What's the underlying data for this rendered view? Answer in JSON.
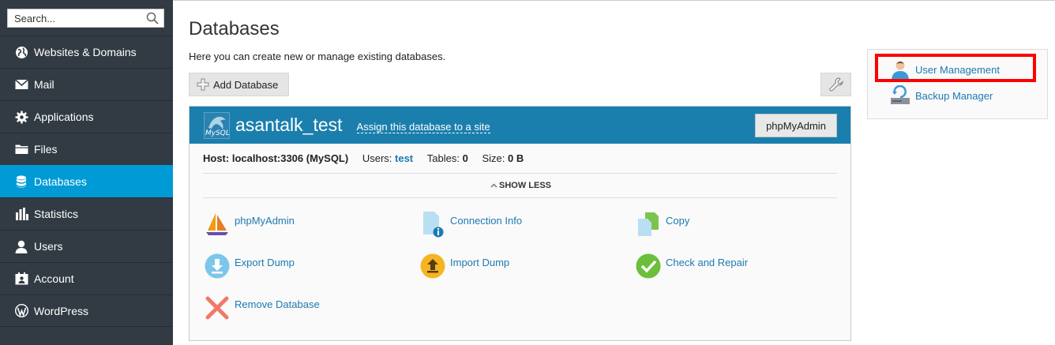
{
  "search": {
    "placeholder": "Search..."
  },
  "sidebar": {
    "items": [
      {
        "label": "Websites & Domains",
        "icon": "globe-icon"
      },
      {
        "label": "Mail",
        "icon": "envelope-icon"
      },
      {
        "label": "Applications",
        "icon": "gear-icon"
      },
      {
        "label": "Files",
        "icon": "folder-icon"
      },
      {
        "label": "Databases",
        "icon": "database-icon",
        "active": true
      },
      {
        "label": "Statistics",
        "icon": "bar-chart-icon"
      },
      {
        "label": "Users",
        "icon": "user-icon"
      },
      {
        "label": "Account",
        "icon": "account-icon"
      },
      {
        "label": "WordPress",
        "icon": "wordpress-icon"
      }
    ]
  },
  "main": {
    "title": "Databases",
    "description": "Here you can create new or manage existing databases.",
    "add_database_label": "Add Database"
  },
  "database": {
    "logo_text": "MySQL",
    "name": "asantalk_test",
    "assign_link": "Assign this database to a site",
    "phpmyadmin_button": "phpMyAdmin",
    "host_text": "Host: localhost:3306 (MySQL)",
    "users_label": "Users:",
    "users_value": "test",
    "tables_label": "Tables:",
    "tables_value": "0",
    "size_label": "Size:",
    "size_value": "0 B",
    "show_less": "SHOW LESS",
    "actions": [
      {
        "label": "phpMyAdmin",
        "icon": "phpmyadmin-icon"
      },
      {
        "label": "Connection Info",
        "icon": "connection-info-icon"
      },
      {
        "label": "Copy",
        "icon": "copy-icon"
      },
      {
        "label": "Export Dump",
        "icon": "export-dump-icon"
      },
      {
        "label": "Import Dump",
        "icon": "import-dump-icon"
      },
      {
        "label": "Check and Repair",
        "icon": "check-icon"
      },
      {
        "label": "Remove Database",
        "icon": "remove-icon"
      }
    ]
  },
  "right_panel": {
    "user_management": "User Management",
    "backup_manager": "Backup Manager"
  },
  "colors": {
    "sidebar_bg": "#323b44",
    "active_blue": "#009bd6",
    "header_blue": "#1b7fad",
    "link_blue": "#1c7ab1",
    "highlight_red": "#ff0000"
  }
}
